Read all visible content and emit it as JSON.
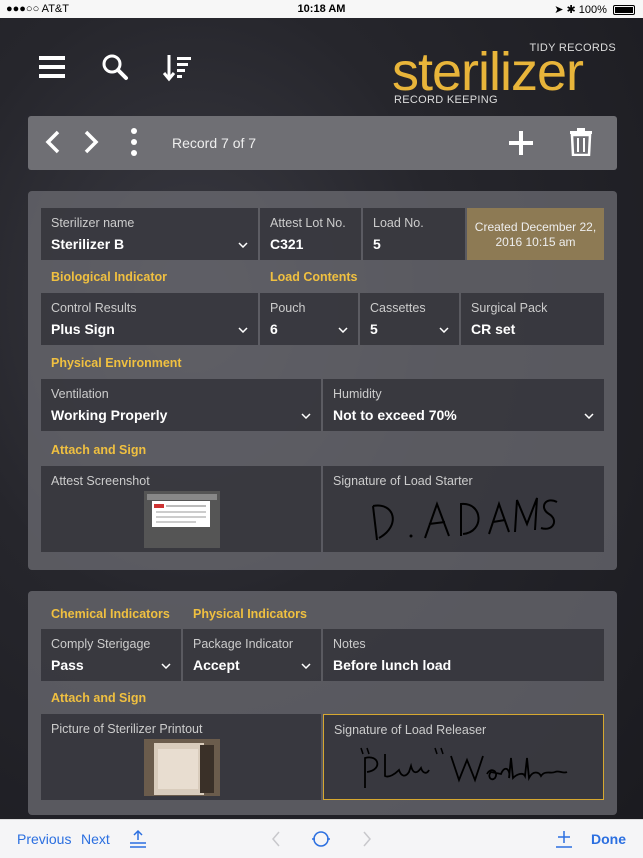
{
  "status": {
    "carrier": "●●●○○ AT&T",
    "time": "10:18 AM",
    "battery": "100%"
  },
  "brand": {
    "tidy": "TIDY RECORDS",
    "name": "sterilizer",
    "sub": "RECORD KEEPING"
  },
  "nav": {
    "record": "Record 7 of 7"
  },
  "card1": {
    "sterilizer_label": "Sterilizer name",
    "sterilizer_value": "Sterilizer B",
    "attest_label": "Attest Lot No.",
    "attest_value": "C321",
    "load_label": "Load No.",
    "load_value": "5",
    "created": "Created December 22, 2016 10:15 am",
    "bio_section": "Biological Indicator",
    "contents_section": "Load Contents",
    "control_label": "Control Results",
    "control_value": "Plus Sign",
    "pouch_label": "Pouch",
    "pouch_value": "6",
    "cassettes_label": "Cassettes",
    "cassettes_value": "5",
    "surgical_label": "Surgical Pack",
    "surgical_value": "CR set",
    "phys_section": "Physical Environment",
    "vent_label": "Ventilation",
    "vent_value": "Working Properly",
    "humidity_label": "Humidity",
    "humidity_value": "Not to exceed  70%",
    "attach_section": "Attach and Sign",
    "screenshot_label": "Attest Screenshot",
    "starter_label": "Signature of Load Starter",
    "starter_sig": "D. ADAMS"
  },
  "card2": {
    "chem_section": "Chemical Indicators",
    "physind_section": "Physical Indicators",
    "comply_label": "Comply Sterigage",
    "comply_value": "Pass",
    "package_label": "Package Indicator",
    "package_value": "Accept",
    "notes_label": "Notes",
    "notes_value": "Before lunch load",
    "attach_section": "Attach and Sign",
    "printout_label": "Picture of Sterilizer Printout",
    "releaser_label": "Signature of Load Releaser",
    "releaser_sig": "\"Plum\" Woodehouse"
  },
  "bottom": {
    "previous": "Previous",
    "next": "Next",
    "done": "Done"
  },
  "colors": {
    "accent": "#e8b53a",
    "link": "#2b6fe0",
    "created_bg": "#8d7a54"
  }
}
